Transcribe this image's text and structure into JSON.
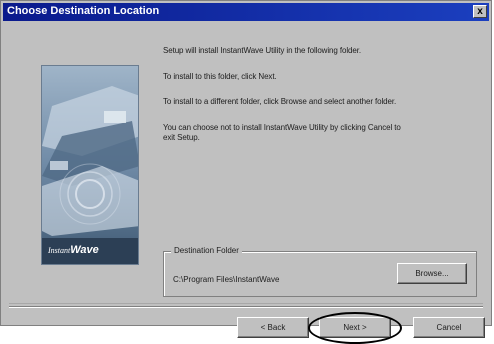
{
  "window": {
    "title": "Choose Destination Location",
    "close_glyph": "x"
  },
  "body_text": {
    "line1": "Setup will install InstantWave Utility in the following folder.",
    "line2": "To install to this folder, click Next.",
    "line3": "To install to a different folder, click Browse and select another folder.",
    "line4a": "You can choose not to install InstantWave Utility by clicking Cancel to",
    "line4b": "exit Setup."
  },
  "banner": {
    "brand_prefix": "Instant",
    "brand_word": "Wave"
  },
  "destination": {
    "group_label": "Destination Folder",
    "path": "C:\\Program Files\\InstantWave",
    "browse_label": "Browse..."
  },
  "buttons": {
    "back_label": "< Back",
    "next_label": "Next >",
    "cancel_label": "Cancel"
  },
  "colors": {
    "titlebar": "#0a1a8c",
    "dialog_bg": "#c0c0c0",
    "annotation_ring": "#000000"
  }
}
